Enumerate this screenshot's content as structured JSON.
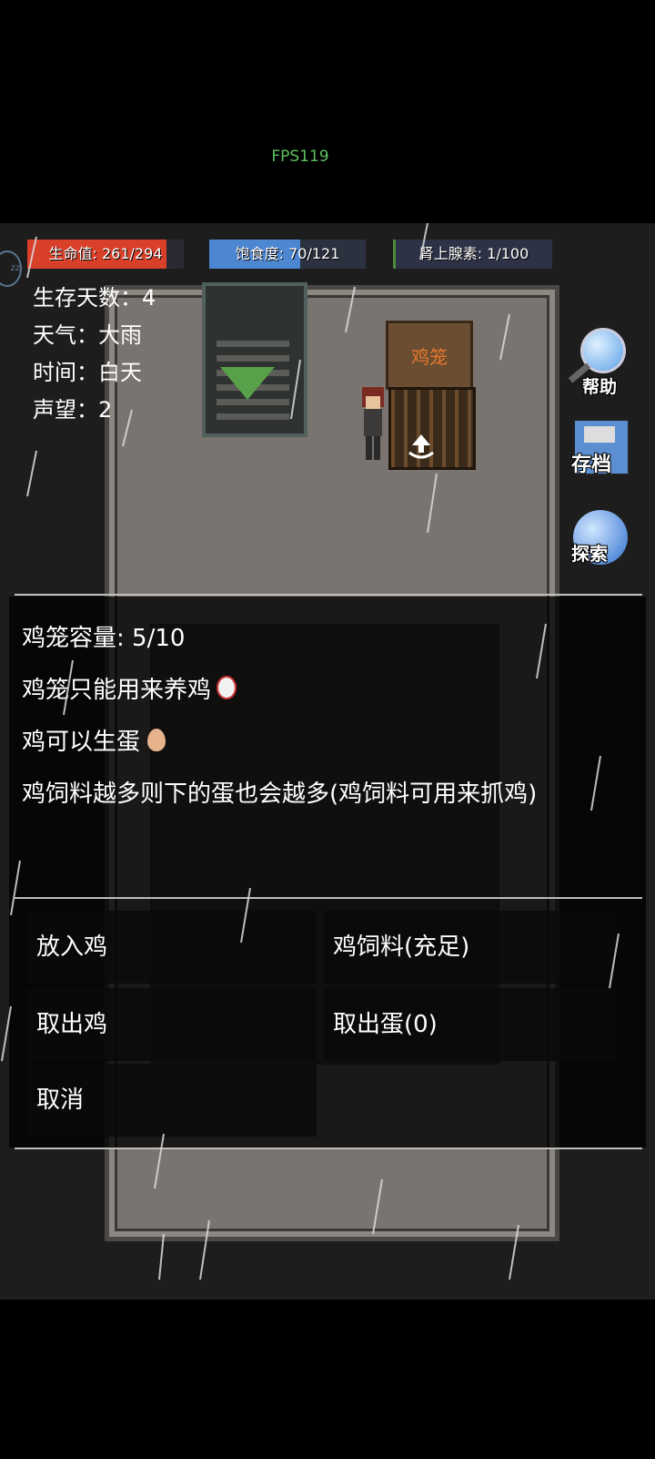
{
  "fps": "FPS119",
  "bars": {
    "hp": {
      "label": "生命值: 261/294",
      "current": 261,
      "max": 294,
      "color": "#d8402a"
    },
    "food": {
      "label": "饱食度: 70/121",
      "current": 70,
      "max": 121,
      "color": "#4d86d1"
    },
    "adrenaline": {
      "label": "肾上腺素: 1/100",
      "current": 1,
      "max": 100,
      "color": "#2d3246"
    }
  },
  "stats": {
    "days": "生存天数：4",
    "weather": "天气：大雨",
    "time": "时间：白天",
    "reputation": "声望：2"
  },
  "map": {
    "coop_sign": "鸡笼"
  },
  "side": {
    "help": "帮助",
    "save": "存档",
    "explore": "探索"
  },
  "dialog": {
    "capacity": "鸡笼容量:  5/10",
    "line1": "鸡笼只能用来养鸡",
    "line2": "鸡可以生蛋",
    "line3": "鸡饲料越多则下的蛋也会越多(鸡饲料可用来抓鸡)"
  },
  "choices": {
    "put_chicken": "放入鸡",
    "feed": "鸡饲料(充足)",
    "take_chicken": "取出鸡",
    "take_egg": "取出蛋(0)",
    "cancel": "取消"
  }
}
